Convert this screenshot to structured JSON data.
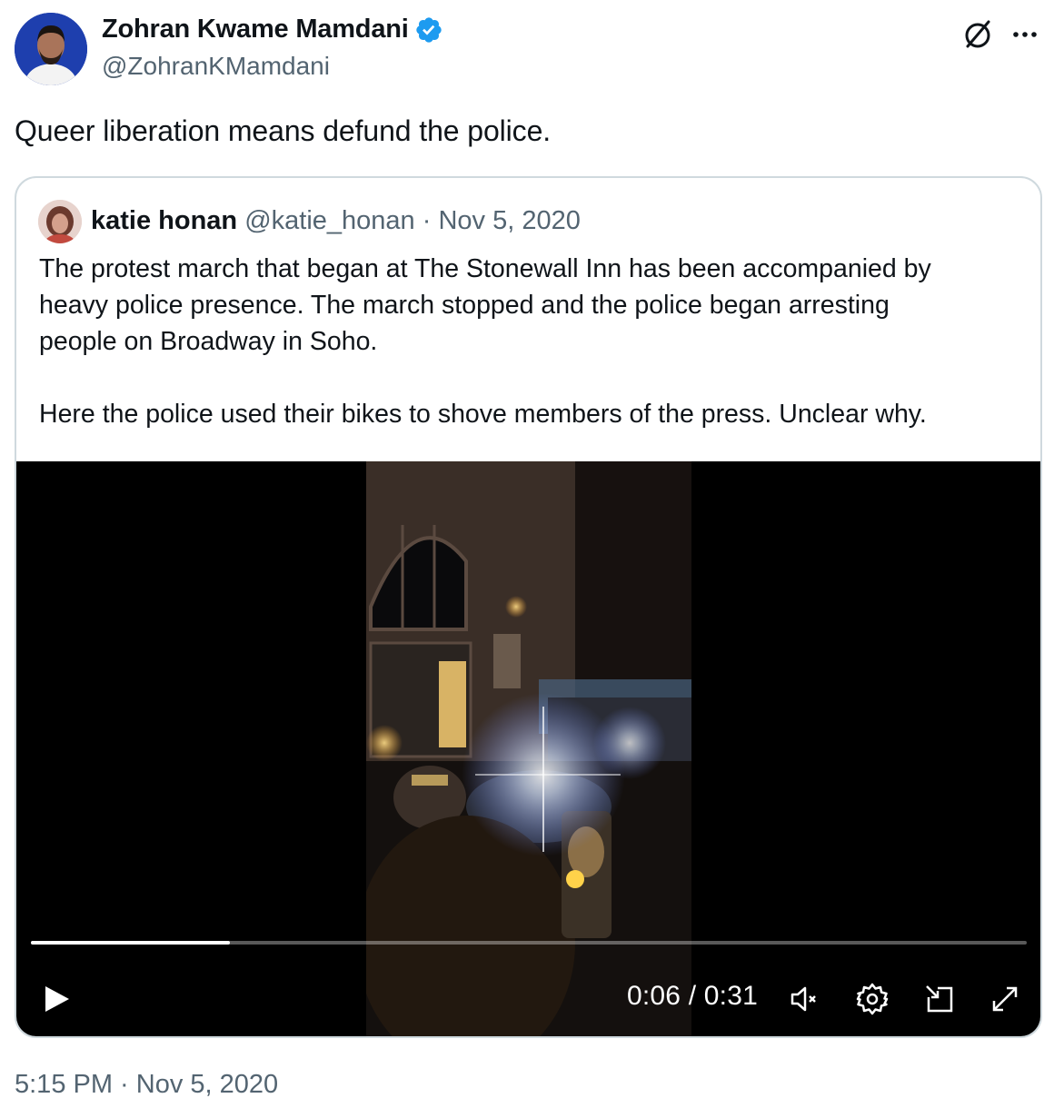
{
  "author": {
    "display_name": "Zohran Kwame Mamdani",
    "handle": "@ZohranKMamdani",
    "verified": true
  },
  "tweet": {
    "text": "Queer liberation means defund the police.",
    "timestamp": "5:15 PM · Nov 5, 2020"
  },
  "quote": {
    "display_name": "katie honan",
    "handle": "@katie_honan",
    "separator": "·",
    "date": "Nov 5, 2020",
    "paragraph1": "The protest march that began at The Stonewall Inn has been accompanied by\nheavy police presence. The march stopped and the police began arresting\npeople on Broadway in Soho.",
    "paragraph2": "Here the police used their bikes to shove members of the press. Unclear why."
  },
  "video": {
    "current_time": "0:06",
    "duration": "0:31",
    "time_label": "0:06 / 0:31",
    "progress": 0.2,
    "muted": true
  },
  "icons": {
    "verified": "verified-badge-icon",
    "grok": "grok-icon",
    "more": "more-icon",
    "play": "play-icon",
    "mute": "mute-icon",
    "settings": "settings-icon",
    "pip": "picture-in-picture-icon",
    "fullscreen": "fullscreen-icon"
  },
  "colors": {
    "text": "#0f1419",
    "secondary": "#536471",
    "accent": "#1d9bf0",
    "border": "#cfd9de"
  }
}
